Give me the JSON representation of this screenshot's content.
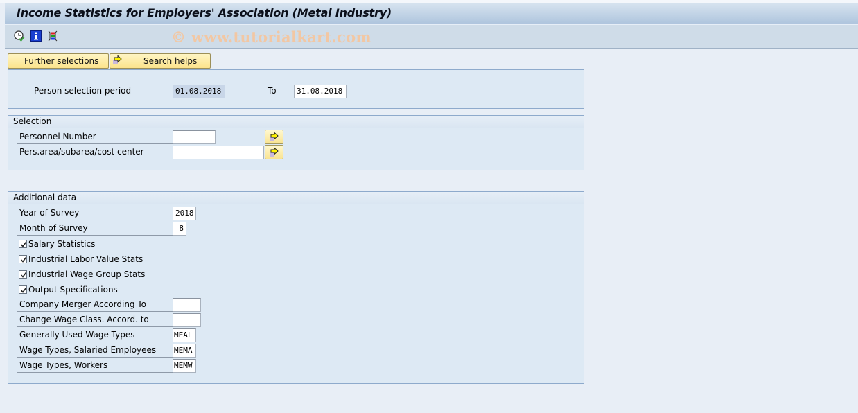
{
  "window": {
    "title": "Income Statistics for Employers' Association (Metal Industry)",
    "watermark": "© www.tutorialkart.com"
  },
  "toolbar": {
    "icons": [
      "execute-clock-icon",
      "info-icon",
      "selection-options-icon"
    ]
  },
  "buttons": {
    "further_selections": "Further selections",
    "search_helps": "Search helps"
  },
  "period": {
    "label": "Person selection period",
    "from": "01.08.2018",
    "to_label": "To",
    "to": "31.08.2018"
  },
  "selection": {
    "title": "Selection",
    "personnel_number_label": "Personnel Number",
    "personnel_number_value": "",
    "pers_area_label": "Pers.area/subarea/cost center",
    "pers_area_value": ""
  },
  "additional": {
    "title": "Additional data",
    "year_label": "Year of Survey",
    "year_value": "2018",
    "month_label": "Month of Survey",
    "month_value": "8",
    "checkboxes": [
      {
        "label": "Salary Statistics",
        "checked": true
      },
      {
        "label": "Industrial Labor Value Stats",
        "checked": true
      },
      {
        "label": "Industrial Wage Group Stats",
        "checked": true
      },
      {
        "label": "Output Specifications",
        "checked": true
      }
    ],
    "merger_label": "Company Merger According To",
    "merger_value": "",
    "wage_class_label": "Change Wage Class. Accord. to",
    "wage_class_value": "",
    "general_wt_label": "Generally Used Wage Types",
    "general_wt_value": "MEAL",
    "salaried_wt_label": "Wage Types, Salaried Employees",
    "salaried_wt_value": "MEMA",
    "workers_wt_label": "Wage Types, Workers",
    "workers_wt_value": "MEMW"
  }
}
